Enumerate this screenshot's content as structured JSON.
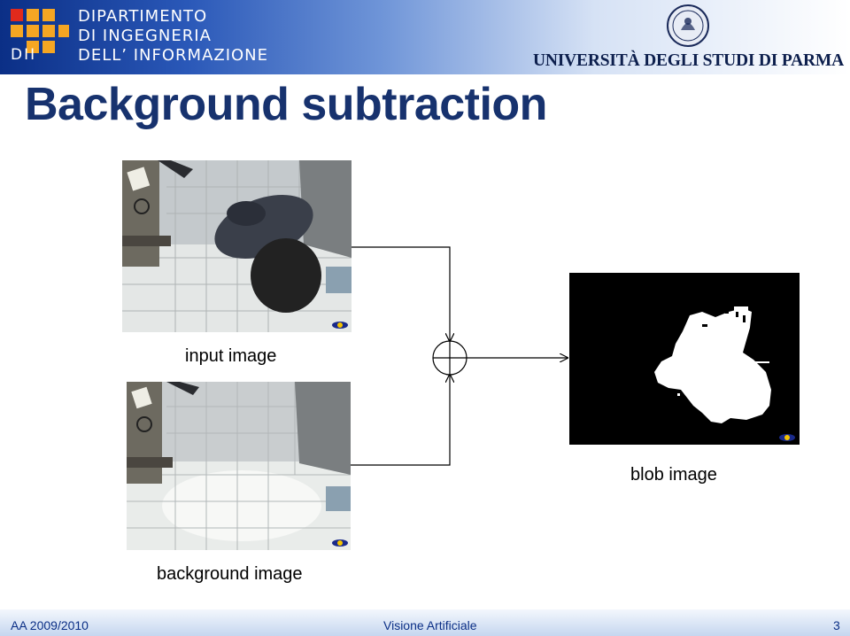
{
  "header": {
    "department_lines": [
      "DIPARTIMENTO",
      "DI INGEGNERIA",
      "DELL’ INFORMAZIONE"
    ],
    "department_abbr": "DII",
    "university": "UNIVERSITÀ DEGLI STUDI DI PARMA",
    "colors": {
      "navy": "#0b2f86",
      "logo_red": "#e02a1c",
      "logo_orange": "#f5a623"
    }
  },
  "slide": {
    "title": "Background subtraction"
  },
  "diagram": {
    "input_caption": "input image",
    "background_caption": "background image",
    "blob_caption": "blob image",
    "operator_icon": "circle-plus-icon"
  },
  "footer": {
    "left": "AA 2009/2010",
    "center": "Visione Artificiale",
    "page": "3"
  }
}
